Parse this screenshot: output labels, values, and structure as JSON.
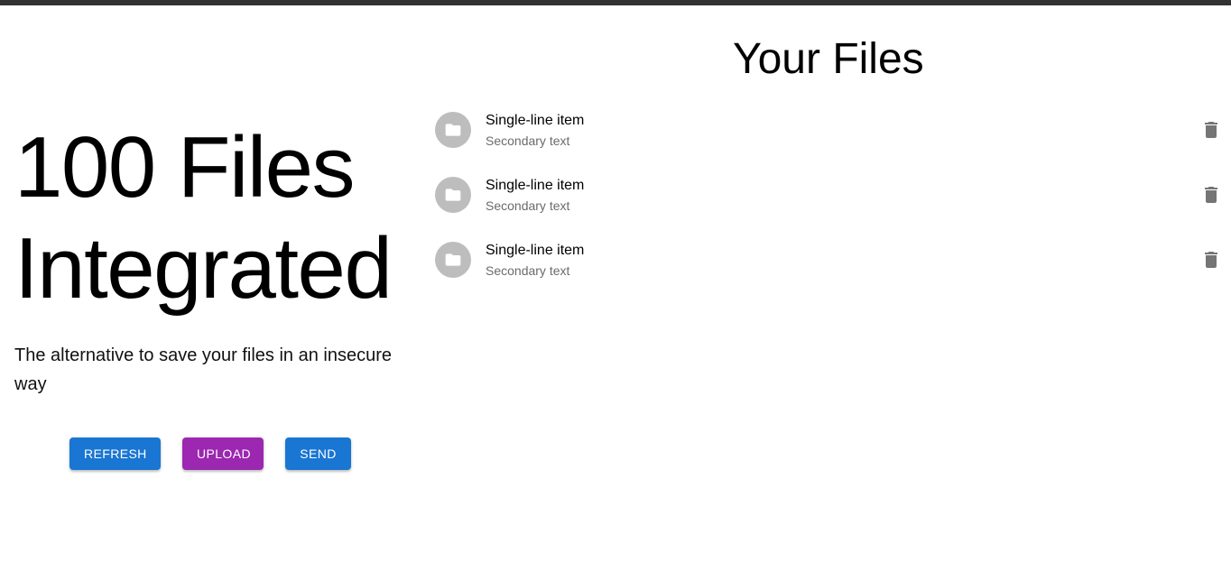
{
  "hero": {
    "title_line1": "100 Files",
    "title_line2": "Integrated",
    "tagline": "The alternative to save your files in an insecure way"
  },
  "actions": {
    "refresh_label": "REFRESH",
    "upload_label": "UPLOAD",
    "send_label": "SEND"
  },
  "files": {
    "title": "Your Files",
    "items": [
      {
        "primary": "Single-line item",
        "secondary": "Secondary text",
        "icon": "folder-icon",
        "action_icon": "delete-icon"
      },
      {
        "primary": "Single-line item",
        "secondary": "Secondary text",
        "icon": "folder-icon",
        "action_icon": "delete-icon"
      },
      {
        "primary": "Single-line item",
        "secondary": "Secondary text",
        "icon": "folder-icon",
        "action_icon": "delete-icon"
      }
    ]
  },
  "colors": {
    "top_bar": "#323232",
    "primary_blue": "#1976d2",
    "upload_purple": "#9c27b0",
    "avatar_gray": "#bdbdbd",
    "icon_gray": "#757575",
    "secondary_text": "#6b6b6b"
  }
}
